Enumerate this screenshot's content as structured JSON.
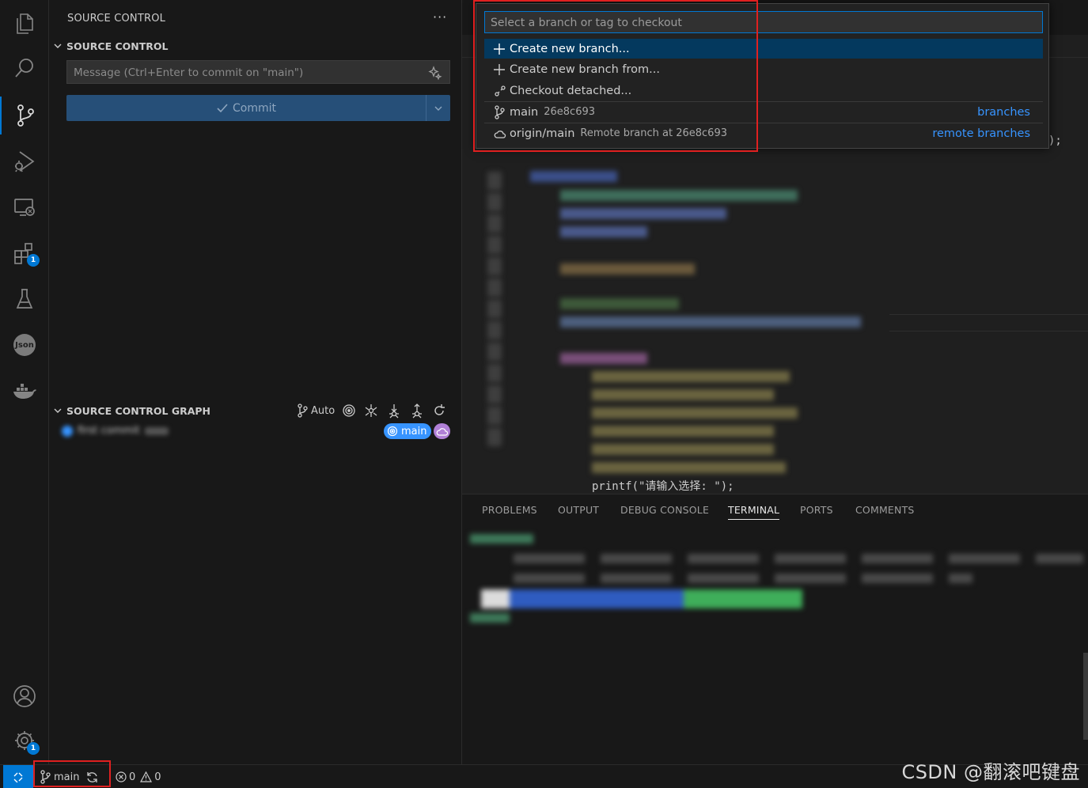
{
  "activity_bar": {
    "items": [
      {
        "name": "explorer-icon"
      },
      {
        "name": "search-icon"
      },
      {
        "name": "source-control-icon",
        "active": true
      },
      {
        "name": "run-debug-icon"
      },
      {
        "name": "remote-explorer-icon"
      },
      {
        "name": "extensions-icon",
        "badge": "1"
      },
      {
        "name": "testing-icon"
      },
      {
        "name": "json-icon",
        "label": "Json"
      },
      {
        "name": "docker-icon"
      }
    ],
    "bottom": [
      {
        "name": "accounts-icon"
      },
      {
        "name": "manage-gear-icon",
        "badge": "1"
      }
    ]
  },
  "sidebar": {
    "title": "SOURCE CONTROL",
    "more": "···",
    "scm_section": {
      "header": "SOURCE CONTROL",
      "message_placeholder": "Message (Ctrl+Enter to commit on \"main\")",
      "commit_label": "Commit"
    },
    "graph_section": {
      "header": "SOURCE CONTROL GRAPH",
      "auto_label": "Auto",
      "commit_message": "first commit",
      "branch_badge": "main"
    }
  },
  "quick_pick": {
    "placeholder": "Select a branch or tag to checkout",
    "items": [
      {
        "icon": "plus-icon",
        "label": "Create new branch...",
        "selected": true
      },
      {
        "icon": "plus-icon",
        "label": "Create new branch from..."
      },
      {
        "icon": "detached-icon",
        "label": "Checkout detached..."
      },
      {
        "icon": "branch-icon",
        "label": "main",
        "description": "26e8c693",
        "group": "branches"
      },
      {
        "icon": "cloud-icon",
        "label": "origin/main",
        "description": "Remote branch at 26e8c693",
        "group": "remote branches"
      }
    ]
  },
  "editor": {
    "visible_line": "printf(\"请输入选择: \");",
    "tail": ");"
  },
  "panel": {
    "tabs": [
      {
        "label": "PROBLEMS"
      },
      {
        "label": "OUTPUT"
      },
      {
        "label": "DEBUG CONSOLE"
      },
      {
        "label": "TERMINAL",
        "active": true
      },
      {
        "label": "PORTS"
      },
      {
        "label": "COMMENTS"
      }
    ]
  },
  "status_bar": {
    "branch": "main",
    "errors": "0",
    "warnings": "0"
  },
  "watermark": "CSDN @翻滚吧键盘",
  "colors": {
    "accent": "#0078d4",
    "highlight_box": "#e02020",
    "link": "#3794ff",
    "selection": "#04395e"
  }
}
